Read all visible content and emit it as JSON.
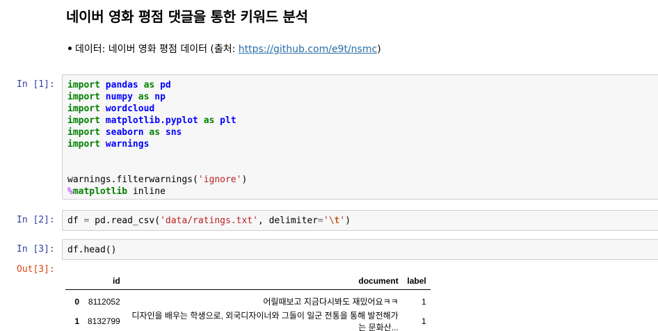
{
  "markdown": {
    "title": "네이버 영화 평점 댓글을 통한 키워드 분석",
    "bullet_prefix": "데이터: 네이버 영화 평점 데이터 (출처: ",
    "bullet_link": "https://github.com/e9t/nsmc",
    "bullet_suffix": ")"
  },
  "cells": [
    {
      "prompt": "In [1]:",
      "lines": [
        [
          "import",
          " ",
          "pandas",
          " ",
          "as",
          " ",
          "pd"
        ],
        [
          "import",
          " ",
          "numpy",
          " ",
          "as",
          " ",
          "np"
        ],
        [
          "import",
          " ",
          "wordcloud"
        ],
        [
          "import",
          " ",
          "matplotlib.pyplot",
          " ",
          "as",
          " ",
          "plt"
        ],
        [
          "import",
          " ",
          "seaborn",
          " ",
          "as",
          " ",
          "sns"
        ],
        [
          "import",
          " ",
          "warnings"
        ],
        [
          "warnings.filterwarnings(",
          "'ignore'",
          ")"
        ],
        [
          "%",
          "matplotlib",
          " inline"
        ]
      ]
    },
    {
      "prompt": "In [2]:",
      "parts": [
        "df ",
        "=",
        " pd.read_csv(",
        "'data/ratings.txt'",
        ", delimiter",
        "=",
        "'",
        "\\t",
        "'",
        ")"
      ]
    },
    {
      "prompt": "In [3]:",
      "parts": [
        "df.head()"
      ]
    }
  ],
  "output": {
    "prompt": "Out[3]:",
    "dataframe": {
      "columns": [
        "",
        "id",
        "document",
        "label"
      ],
      "rows": [
        [
          "0",
          "8112052",
          "어릴때보고 지금다시봐도 재밌어요ㅋㅋ",
          "1"
        ],
        [
          "1",
          "8132799",
          "디자인을 배우는 학생으로, 외국디자이너와 그들이 일군 전통을 통해 발전해가는 문화산...",
          "1"
        ]
      ]
    }
  }
}
